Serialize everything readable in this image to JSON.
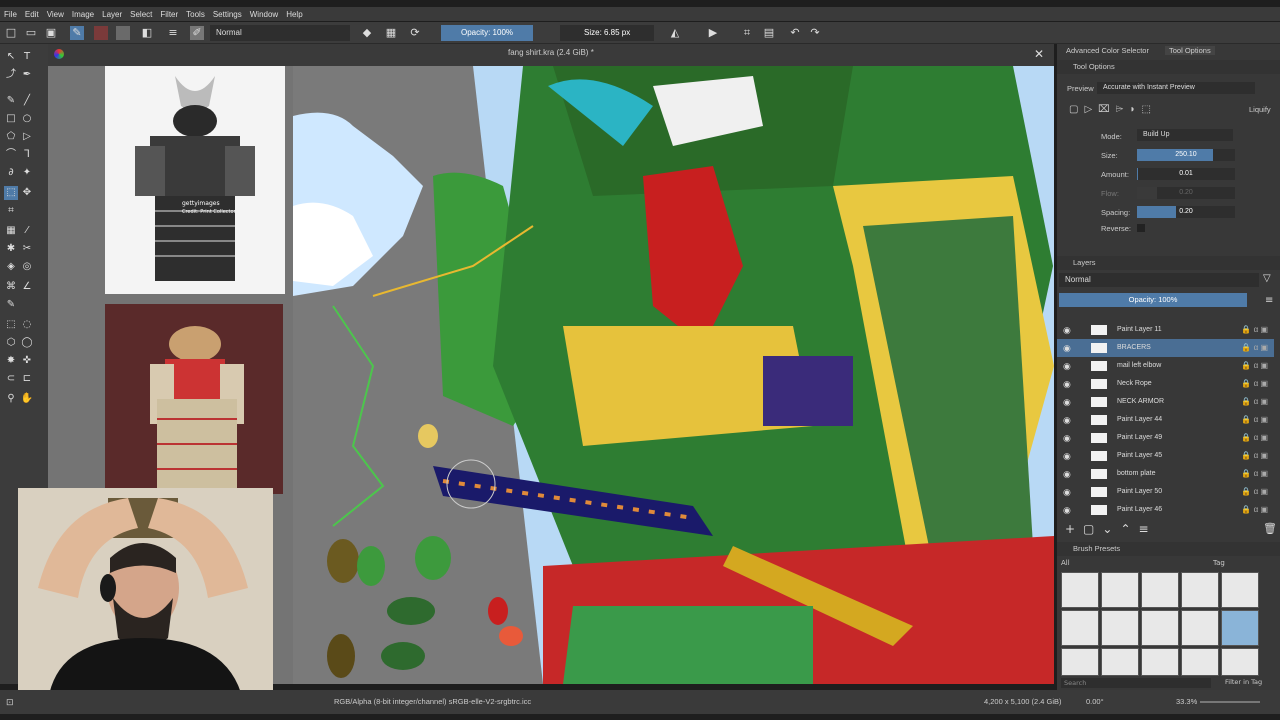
{
  "menu": [
    "File",
    "Edit",
    "View",
    "Image",
    "Layer",
    "Select",
    "Filter",
    "Tools",
    "Settings",
    "Window",
    "Help"
  ],
  "toolbar": {
    "blend_mode": "Normal",
    "opacity": "Opacity: 100%",
    "size": "Size: 6.85 px"
  },
  "document": {
    "tab_title": "fang shirt.kra (2.4 GiB) *"
  },
  "reference": {
    "watermark": "gettyimages",
    "credit": "Credit: Print Collector"
  },
  "docker": {
    "tabs": [
      "Advanced Color Selector",
      "Tool Options"
    ],
    "tool_options_title": "Tool Options",
    "preview_label": "Preview",
    "preview_value": "Accurate with Instant Preview",
    "liquify_label": "Liquify",
    "mode_label": "Mode:",
    "mode_value": "Build Up",
    "size_label": "Size:",
    "size_value": "250.10",
    "size_fraction": 0.78,
    "amount_label": "Amount:",
    "amount_value": "0.01",
    "amount_fraction": 0.01,
    "flow_label": "Flow:",
    "flow_value": "0.20",
    "flow_fraction": 0.2,
    "spacing_label": "Spacing:",
    "spacing_value": "0.20",
    "spacing_fraction": 0.4,
    "reverse_label": "Reverse:"
  },
  "layers": {
    "title": "Layers",
    "blend": "Normal",
    "opacity": "Opacity: 100%",
    "items": [
      {
        "name": "Paint Layer 11",
        "selected": false
      },
      {
        "name": "BRACERS",
        "selected": true
      },
      {
        "name": "mail left elbow",
        "selected": false
      },
      {
        "name": "Neck Rope",
        "selected": false
      },
      {
        "name": "NECK ARMOR",
        "selected": false
      },
      {
        "name": "Paint Layer 44",
        "selected": false
      },
      {
        "name": "Paint Layer 49",
        "selected": false
      },
      {
        "name": "Paint Layer 45",
        "selected": false
      },
      {
        "name": "bottom plate",
        "selected": false
      },
      {
        "name": "Paint Layer 50",
        "selected": false
      },
      {
        "name": "Paint Layer 46",
        "selected": false
      }
    ]
  },
  "brush_presets": {
    "title": "Brush Presets",
    "filter": "All",
    "tag_label": "Tag",
    "search_placeholder": "Search",
    "filter_in_tag": "Filter in Tag"
  },
  "status": {
    "color_space": "RGB/Alpha (8-bit integer/channel)  sRGB-elle-V2-srgbtrc.icc",
    "dims": "4,200 x 5,100 (2.4 GiB)",
    "rotation": "0.00°",
    "zoom": "33.3%"
  },
  "colors": {
    "accent": "#4f7ba8",
    "panel": "#383838",
    "selected_row": "#4a6e94"
  }
}
